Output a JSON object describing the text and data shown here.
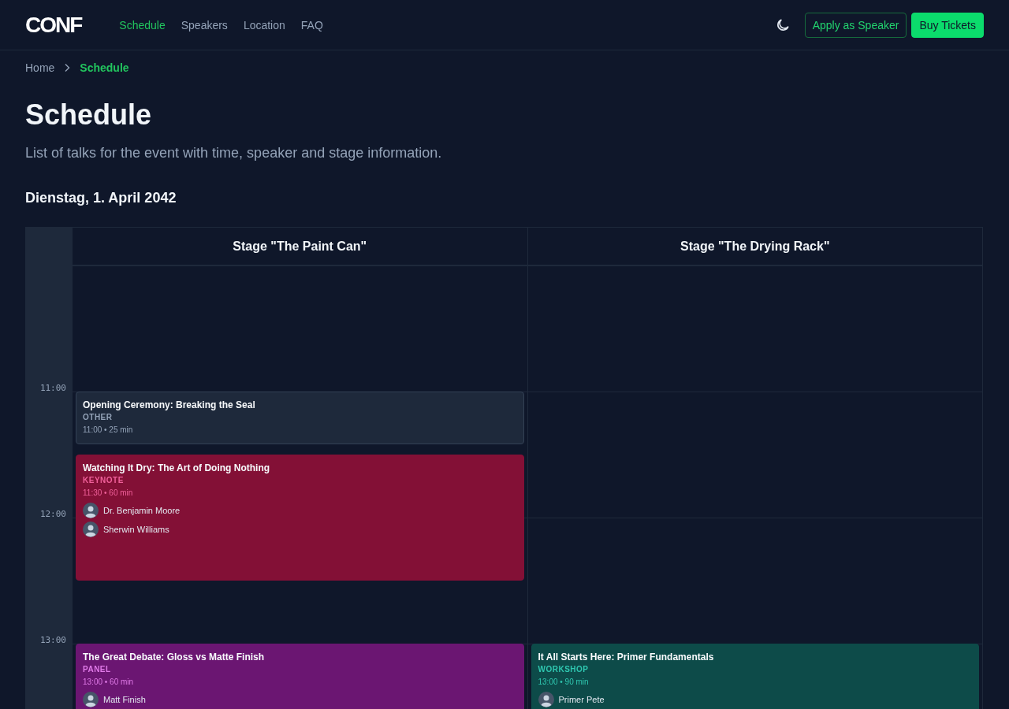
{
  "header": {
    "logo": "CONF",
    "nav": [
      {
        "label": "Schedule",
        "selected": true
      },
      {
        "label": "Speakers",
        "selected": false
      },
      {
        "label": "Location",
        "selected": false
      },
      {
        "label": "FAQ",
        "selected": false
      }
    ],
    "buttons": [
      {
        "label": "Apply as Speaker",
        "kind": "outline"
      },
      {
        "label": "Buy Tickets",
        "kind": "primary"
      }
    ]
  },
  "breadcrumb": [
    {
      "label": "Home",
      "selected": false
    },
    {
      "label": "Schedule",
      "selected": true
    }
  ],
  "title": "Schedule",
  "subtitle": "List of talks for the event with time, speaker and stage information.",
  "day": "Dienstag, 1. April 2042",
  "schedule": {
    "time_labels": [
      "11:00",
      "12:00",
      "13:00"
    ],
    "stages": [
      {
        "name": "Stage \"The Paint Can\"",
        "sessions": [
          {
            "title": "Opening Ceremony: Breaking the Seal",
            "kind": "other",
            "category": "OTHER",
            "meta": "11:00 • 25 min"
          },
          {
            "title": "Watching It Dry: The Art of Doing Nothing",
            "kind": "keynote",
            "category": "KEYNOTE",
            "meta": "11:30 • 60 min",
            "speakers": [
              "Dr. Benjamin Moore",
              "Sherwin Williams"
            ]
          },
          {
            "title": "The Great Debate: Gloss vs Matte Finish",
            "kind": "panel",
            "category": "PANEL",
            "meta": "13:00 • 60 min",
            "speakers": [
              "Matt Finish"
            ]
          }
        ]
      },
      {
        "name": "Stage \"The Drying Rack\"",
        "sessions": [
          {
            "title": "It All Starts Here: Primer Fundamentals",
            "kind": "workshop",
            "category": "WORKSHOP",
            "meta": "13:00 • 90 min",
            "speakers": [
              "Primer Pete"
            ]
          }
        ]
      }
    ]
  }
}
